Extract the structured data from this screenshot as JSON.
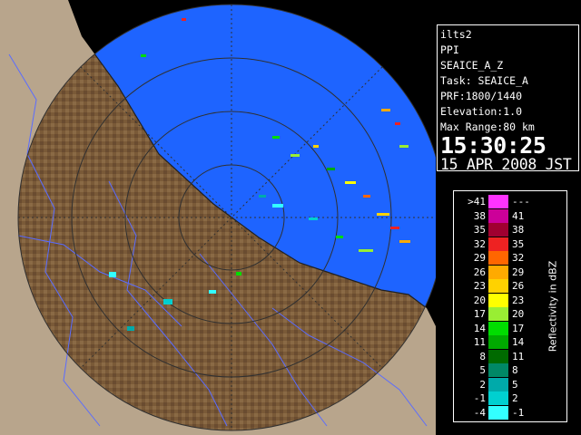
{
  "info": {
    "site": "ilts2",
    "product": "PPI",
    "volume": "SEAICE_A_Z",
    "task": "Task: SEAICE_A",
    "prf": "PRF:1800/1440",
    "elevation": "Elevation:1.0",
    "max_range": "Max Range:80 km",
    "time": "15:30:25",
    "date": "15 APR 2008 JST"
  },
  "legend": {
    "title": "Reflectivity in dBZ",
    "rows": [
      {
        "min": ">41",
        "max": "---",
        "color": "#ff33ff"
      },
      {
        "min": "38",
        "max": "41",
        "color": "#cc0099"
      },
      {
        "min": "35",
        "max": "38",
        "color": "#a00030"
      },
      {
        "min": "32",
        "max": "35",
        "color": "#ee2222"
      },
      {
        "min": "29",
        "max": "32",
        "color": "#ff6600"
      },
      {
        "min": "26",
        "max": "29",
        "color": "#ffaa00"
      },
      {
        "min": "23",
        "max": "26",
        "color": "#ffd200"
      },
      {
        "min": "20",
        "max": "23",
        "color": "#ffff00"
      },
      {
        "min": "17",
        "max": "20",
        "color": "#99ee33"
      },
      {
        "min": "14",
        "max": "17",
        "color": "#00dd00"
      },
      {
        "min": "11",
        "max": "14",
        "color": "#00aa00"
      },
      {
        "min": "8",
        "max": "11",
        "color": "#006a00"
      },
      {
        "min": "5",
        "max": "8",
        "color": "#008866"
      },
      {
        "min": "2",
        "max": "5",
        "color": "#00aaaa"
      },
      {
        "min": "-1",
        "max": "2",
        "color": "#00d0d0"
      },
      {
        "min": "-4",
        "max": "-1",
        "color": "#33ffff"
      }
    ]
  },
  "map": {
    "sea_color": "#1e64ff",
    "land_color": "#7a5a38",
    "beyond_range_color": "#b8a58c"
  }
}
